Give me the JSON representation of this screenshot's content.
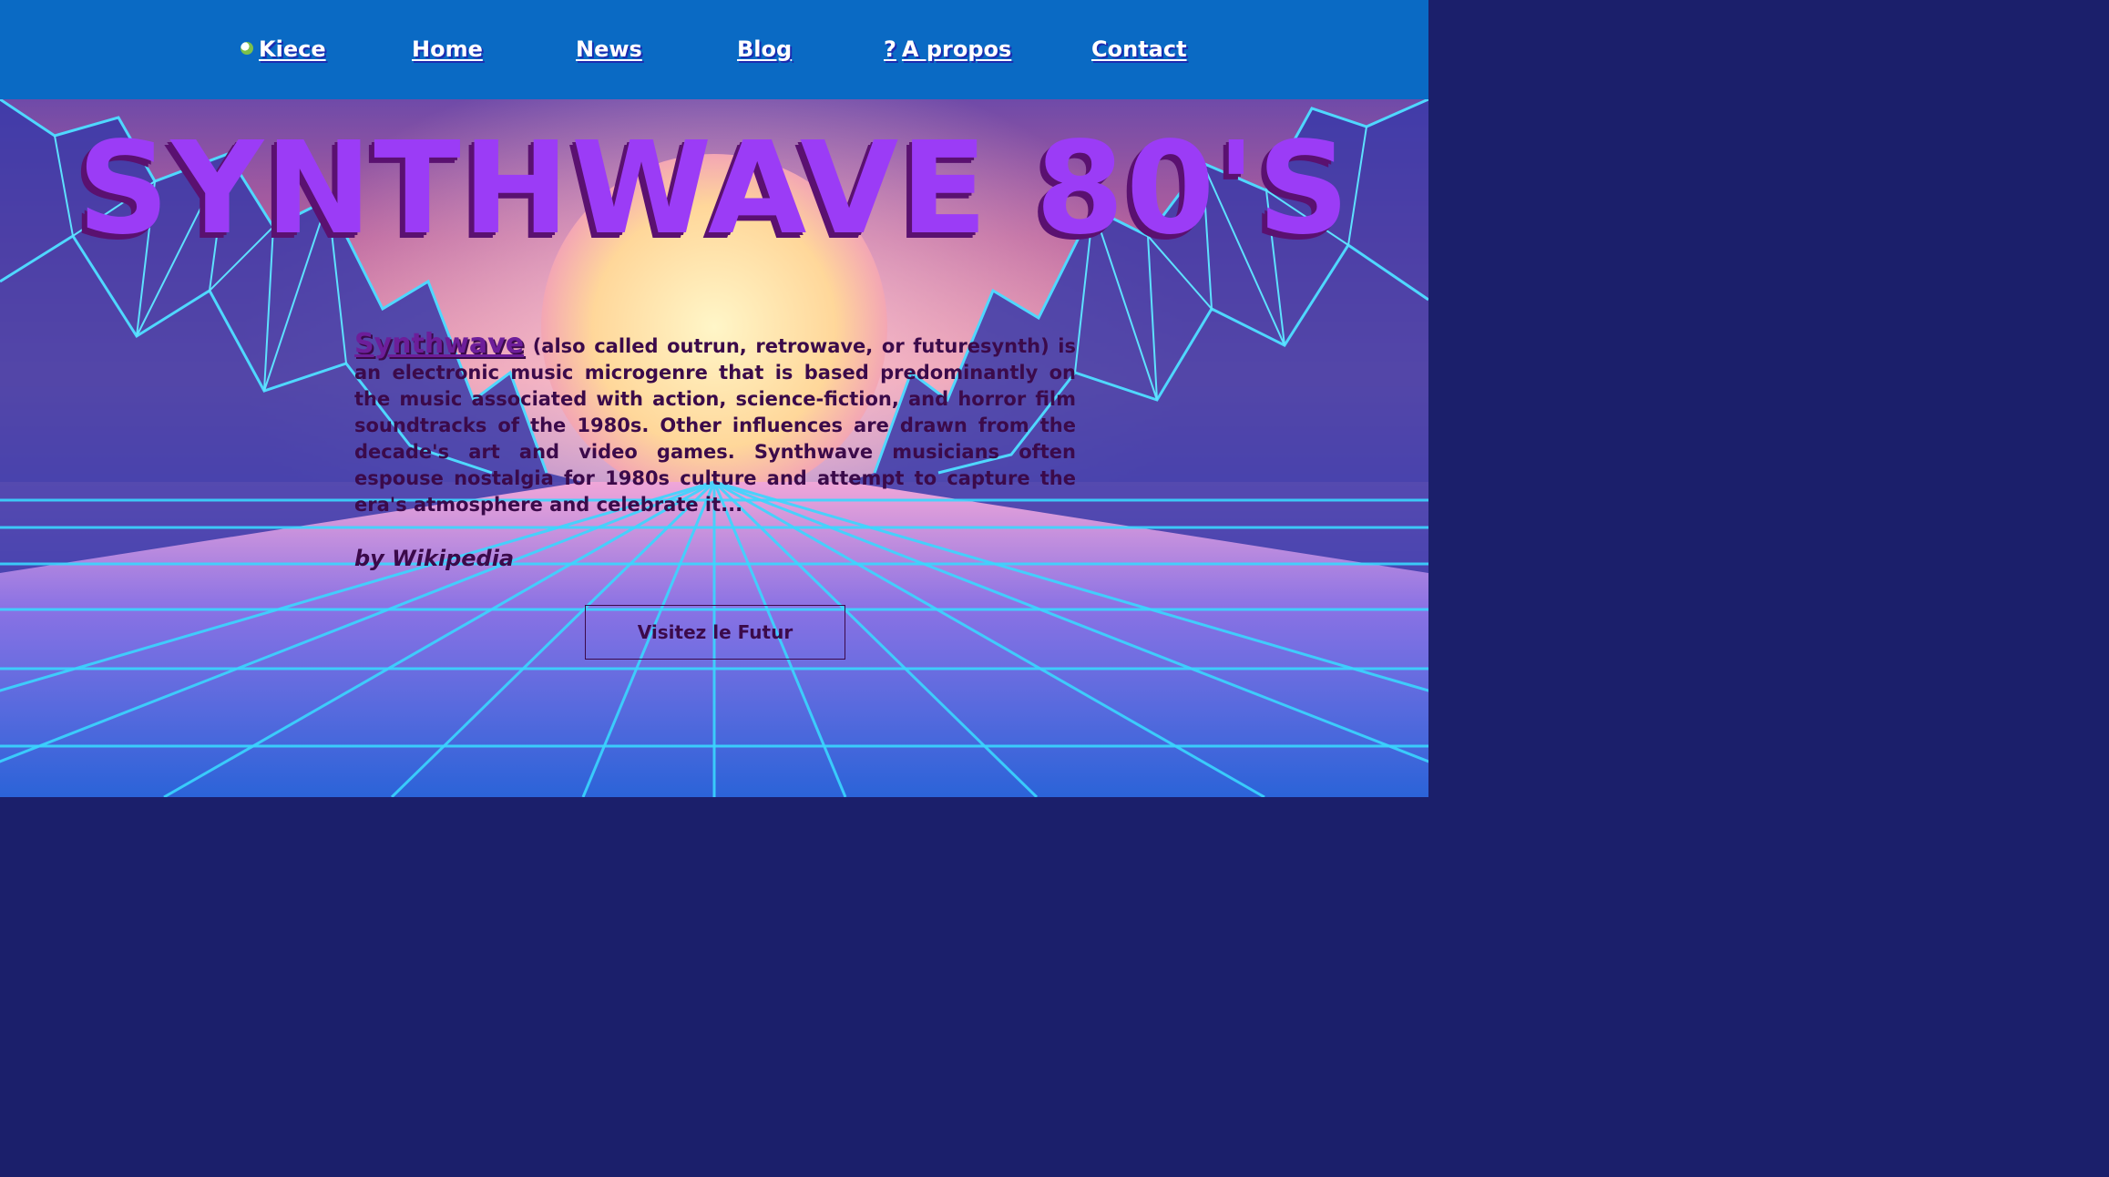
{
  "colors": {
    "nav_bg": "#0a6ac4",
    "title": "#9b3cf6",
    "title_shadow": "#5a1170",
    "text": "#3b0a4a",
    "grid": "#3ad7ff"
  },
  "nav": {
    "items": [
      {
        "label": "Kiece",
        "icon": "kiece-logo-icon"
      },
      {
        "label": "Home",
        "icon": "home-icon",
        "glyph": ""
      },
      {
        "label": "News",
        "icon": "news-icon",
        "glyph": ""
      },
      {
        "label": "Blog",
        "icon": "blog-icon",
        "glyph": ""
      },
      {
        "label": "A propos",
        "icon": "question-icon",
        "glyph": "?"
      },
      {
        "label": "Contact",
        "icon": "contact-icon",
        "glyph": ""
      }
    ]
  },
  "hero": {
    "title": "SYNTHWAVE 80'S",
    "intro_link": "Synthwave",
    "intro_text": " (also called outrun, retrowave, or futuresynth) is an electronic music microgenre that is based predominantly on the music associated with action, science-fiction, and horror film soundtracks of the 1980s. Other influences are drawn from the decade's art and video games. Synthwave musicians often espouse nostalgia for 1980s culture and attempt to capture the era's atmosphere and celebrate it...",
    "byline": "by Wikipedia",
    "cta_label": "Visitez le Futur"
  }
}
